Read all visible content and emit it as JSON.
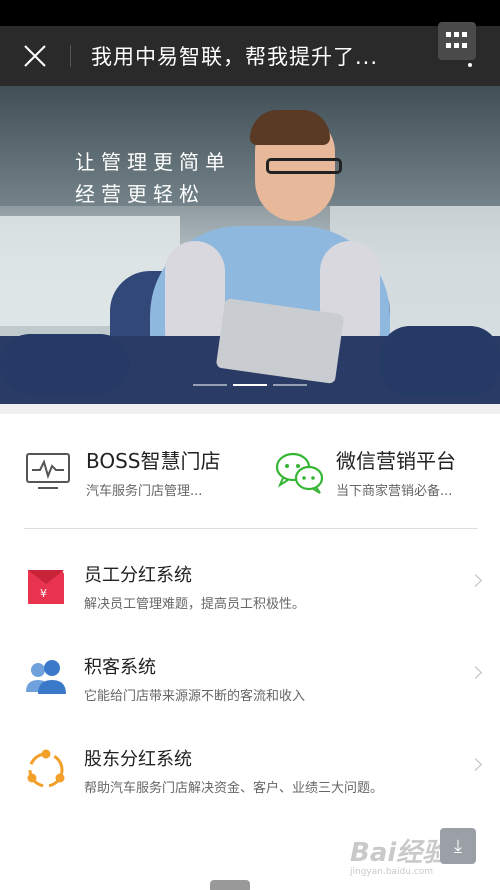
{
  "header": {
    "title": "我用中易智联，帮我提升了..."
  },
  "banner": {
    "slogan_line1": "让管理更简单",
    "slogan_line2": "经营更轻松",
    "active_slide": 2,
    "slide_count": 3
  },
  "features": [
    {
      "title": "BOSS智慧门店",
      "subtitle": "汽车服务门店管理...",
      "icon": "monitor-pulse-icon"
    },
    {
      "title": "微信营销平台",
      "subtitle": "当下商家营销必备...",
      "icon": "wechat-icon"
    }
  ],
  "list": [
    {
      "title": "员工分红系统",
      "desc": "解决员工管理难题，提高员工积极性。",
      "icon": "red-envelope-icon"
    },
    {
      "title": "积客系统",
      "desc": "它能给门店带来源源不断的客流和收入",
      "icon": "people-icon"
    },
    {
      "title": "股东分红系统",
      "desc": "帮助汽车服务门店解决资金、客户、业绩三大问题。",
      "icon": "circle-dots-icon"
    }
  ],
  "watermark": {
    "brand": "Bai",
    "brand_cn": "经验",
    "url": "jingyan.baidu.com"
  },
  "colors": {
    "nav_bg": "#2a2a2a",
    "wechat_green": "#35b534",
    "red": "#e8344e",
    "blue": "#3a78c9",
    "orange": "#f2a02a"
  }
}
